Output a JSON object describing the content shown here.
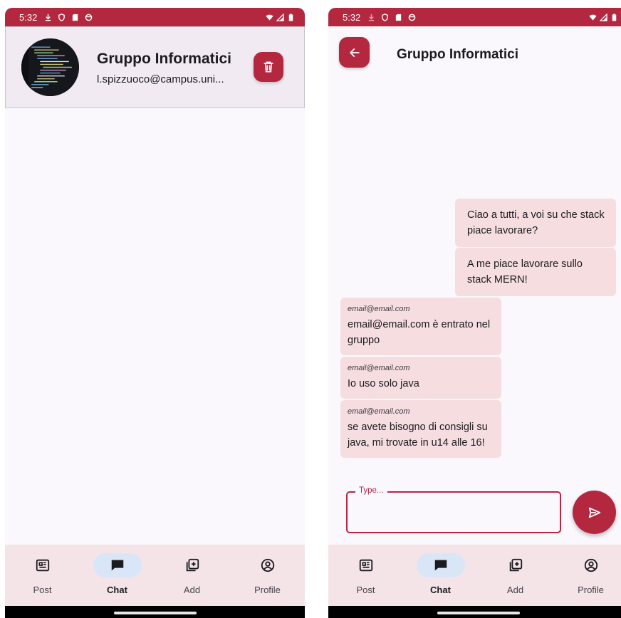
{
  "status_bar": {
    "time": "5:32"
  },
  "group": {
    "title": "Gruppo Informatici",
    "email": "l.spizzuoco@campus.uni..."
  },
  "chat": {
    "title": "Gruppo Informatici",
    "sent_messages": [
      "Ciao a tutti, a voi su che stack piace lavorare?",
      "A me piace lavorare sullo stack MERN!"
    ],
    "received_messages": [
      {
        "sender": "email@email.com",
        "text": "email@email.com è entrato nel gruppo"
      },
      {
        "sender": "email@email.com",
        "text": "Io uso solo java"
      },
      {
        "sender": "email@email.com",
        "text": "se avete bisogno di consigli su java, mi trovate in u14 alle 16!"
      }
    ],
    "input_label": "Type...",
    "input_value": ""
  },
  "nav": {
    "items": [
      {
        "label": "Post",
        "icon": "newspaper-icon"
      },
      {
        "label": "Chat",
        "icon": "chat-icon"
      },
      {
        "label": "Add",
        "icon": "add-library-icon"
      },
      {
        "label": "Profile",
        "icon": "account-circle-icon"
      }
    ],
    "active": "Chat"
  },
  "colors": {
    "primary": "#b3273f",
    "bubble": "#f5dde0",
    "surface": "#fbf8fd",
    "card": "#f1eaf2",
    "nav_bg": "#f4e4e8",
    "nav_active_pill": "#d8e6f8"
  }
}
